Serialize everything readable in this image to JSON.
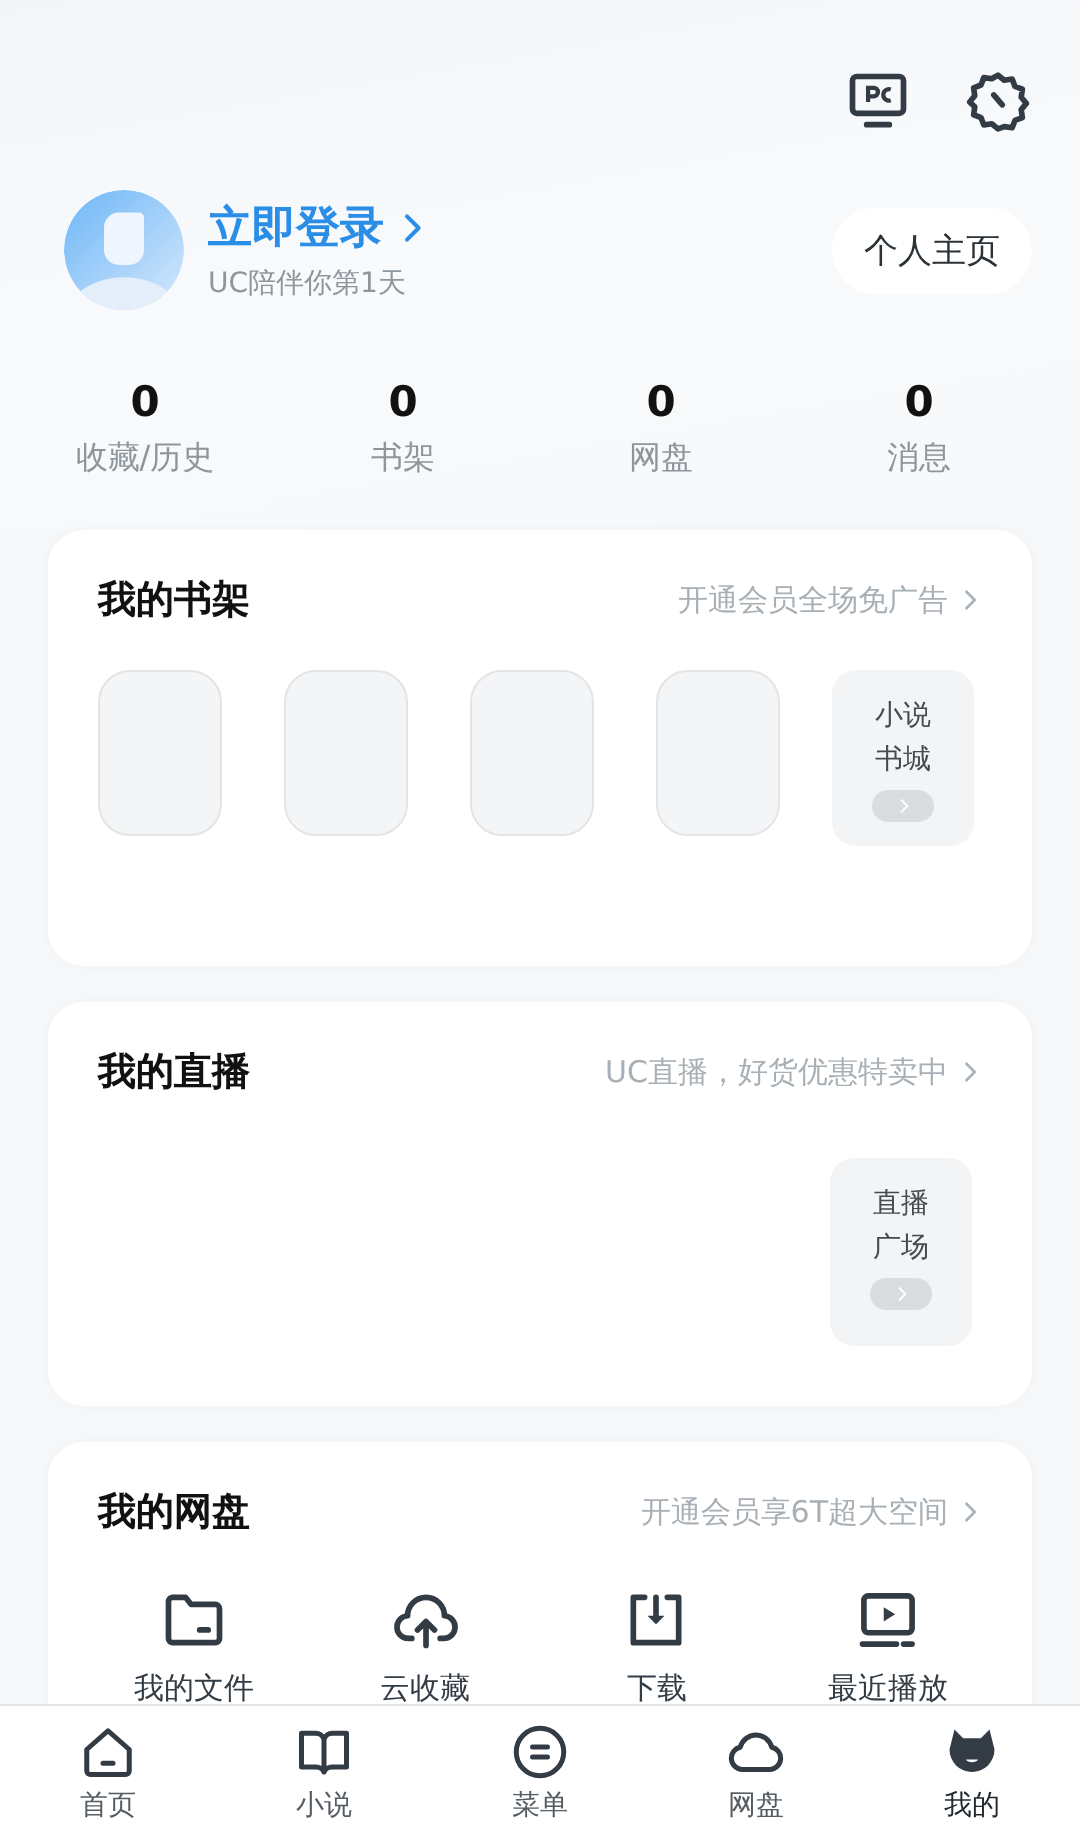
{
  "header": {
    "login_title": "立即登录",
    "subtitle": "UC陪伴你第1天",
    "profile_button": "个人主页"
  },
  "stats": [
    {
      "value": "0",
      "label": "收藏/历史"
    },
    {
      "value": "0",
      "label": "书架"
    },
    {
      "value": "0",
      "label": "网盘"
    },
    {
      "value": "0",
      "label": "消息"
    }
  ],
  "cards": [
    {
      "kind": "bookshelf",
      "title": "我的书架",
      "link": "开通会员全场免广告",
      "tile": [
        "小说",
        "书城"
      ]
    },
    {
      "kind": "live",
      "title": "我的直播",
      "link": "UC直播，好货优惠特卖中",
      "tile": [
        "直播",
        "广场"
      ]
    },
    {
      "kind": "netdisk",
      "title": "我的网盘",
      "link": "开通会员享6T超大空间",
      "items": [
        {
          "label": "我的文件"
        },
        {
          "label": "云收藏"
        },
        {
          "label": "下载"
        },
        {
          "label": "最近播放"
        }
      ]
    }
  ],
  "tabbar": [
    {
      "label": "首页",
      "selected": false
    },
    {
      "label": "小说",
      "selected": false
    },
    {
      "label": "菜单",
      "selected": false
    },
    {
      "label": "网盘",
      "selected": false
    },
    {
      "label": "我的",
      "selected": true
    }
  ]
}
